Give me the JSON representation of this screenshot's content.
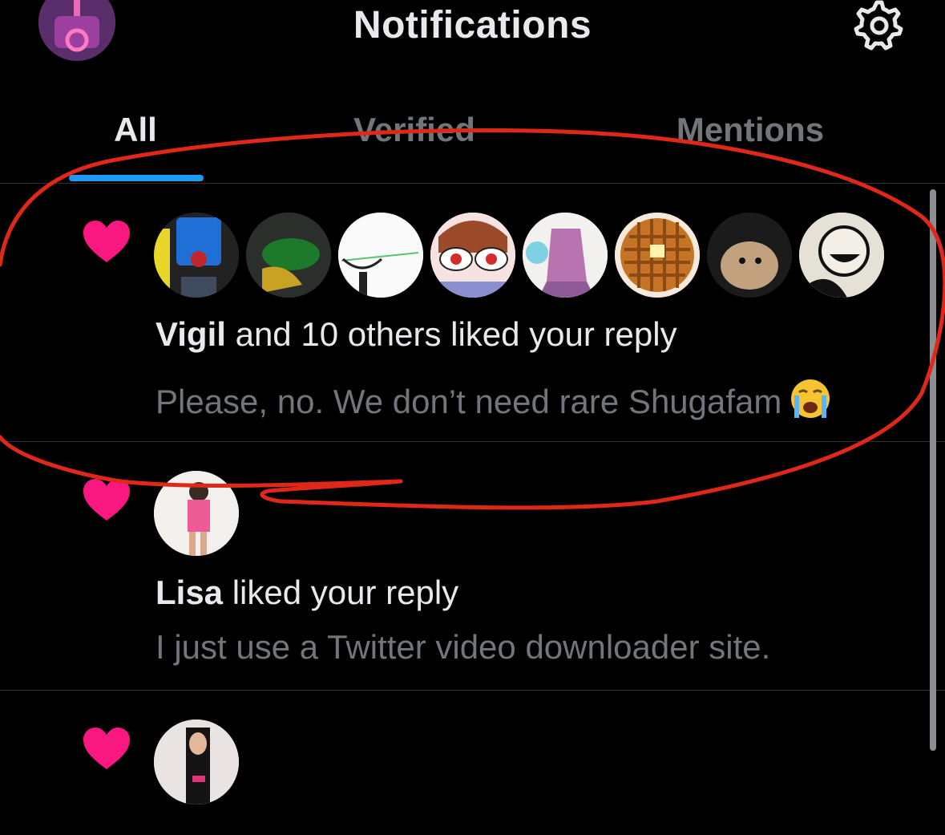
{
  "header": {
    "title": "Notifications",
    "avatar_icon": "profile-avatar",
    "settings_icon": "gear-icon"
  },
  "tabs": [
    {
      "label": "All",
      "active": true
    },
    {
      "label": "Verified",
      "active": false
    },
    {
      "label": "Mentions",
      "active": false
    }
  ],
  "notifications": [
    {
      "icon": "heart-icon",
      "avatar_count": 8,
      "actor": "Vigil",
      "action": " and 10 others liked your reply",
      "snippet": "Please, no. We don’t need rare Shugafam",
      "snippet_emoji": "loudly-crying-face"
    },
    {
      "icon": "heart-icon",
      "avatar_count": 1,
      "actor": "Lisa",
      "action": " liked your reply",
      "snippet": "I just use a Twitter video downloader site."
    },
    {
      "icon": "heart-icon",
      "avatar_count": 1,
      "actor": "",
      "action": "",
      "snippet": ""
    }
  ],
  "colors": {
    "accent": "#1d9bf0",
    "like": "#f91880",
    "annotation": "#e0281a",
    "text_secondary": "#71767b"
  }
}
